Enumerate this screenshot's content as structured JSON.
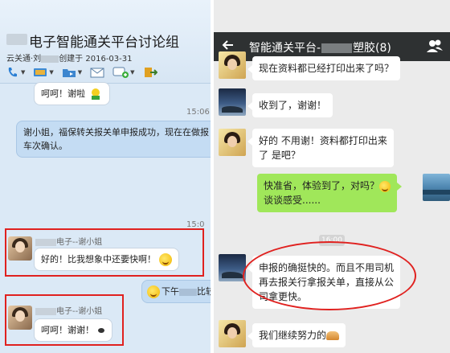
{
  "left": {
    "group_title": "电子智能通关平台讨论组",
    "subtitle_prefix": "云关通·刘",
    "subtitle_suffix": "创建于 2016-03-31",
    "messages": [
      {
        "text": "呵呵！谢啦"
      },
      {
        "timestamp": "15:06"
      },
      {
        "text": "谢小姐，福保转关报关单申报成功，现在在做报",
        "text2": "车次确认。"
      },
      {
        "timestamp": "15:0"
      },
      {
        "sender": "电子--谢小姐",
        "text": "好的！比我想象中还要快啊！"
      },
      {
        "text": "下午",
        "text_tail": "比较"
      },
      {
        "sender": "电子--谢小姐",
        "text": "呵呵！谢谢！"
      }
    ]
  },
  "right": {
    "title_prefix": "智能通关平台-",
    "title_suffix": "塑胶(8)",
    "back_icon": "back-arrow-icon",
    "people_icon": "group-members-icon",
    "messages": [
      {
        "side": "left",
        "text": "现在资料都已经打印出来了吗？"
      },
      {
        "side": "left",
        "text": "收到了，谢谢！"
      },
      {
        "side": "left",
        "text": "好的 不用谢！资料都打印出来",
        "text2": "了 是吧？"
      },
      {
        "side": "right",
        "text": "快准省，体验到了，对吗？",
        "text2": "谈谈感受......"
      },
      {
        "timestamp": "16:00"
      },
      {
        "side": "left",
        "text": "申报的确挺快的。而且不用司机",
        "text2": "再去报关行拿报关单，直接从公",
        "text3": "司拿更快。"
      },
      {
        "side": "left",
        "text": "我们继续努力的"
      }
    ]
  },
  "colors": {
    "highlight_red": "#e0211f",
    "wechat_green": "#a0e75a",
    "wechat_header": "#2e3132"
  }
}
